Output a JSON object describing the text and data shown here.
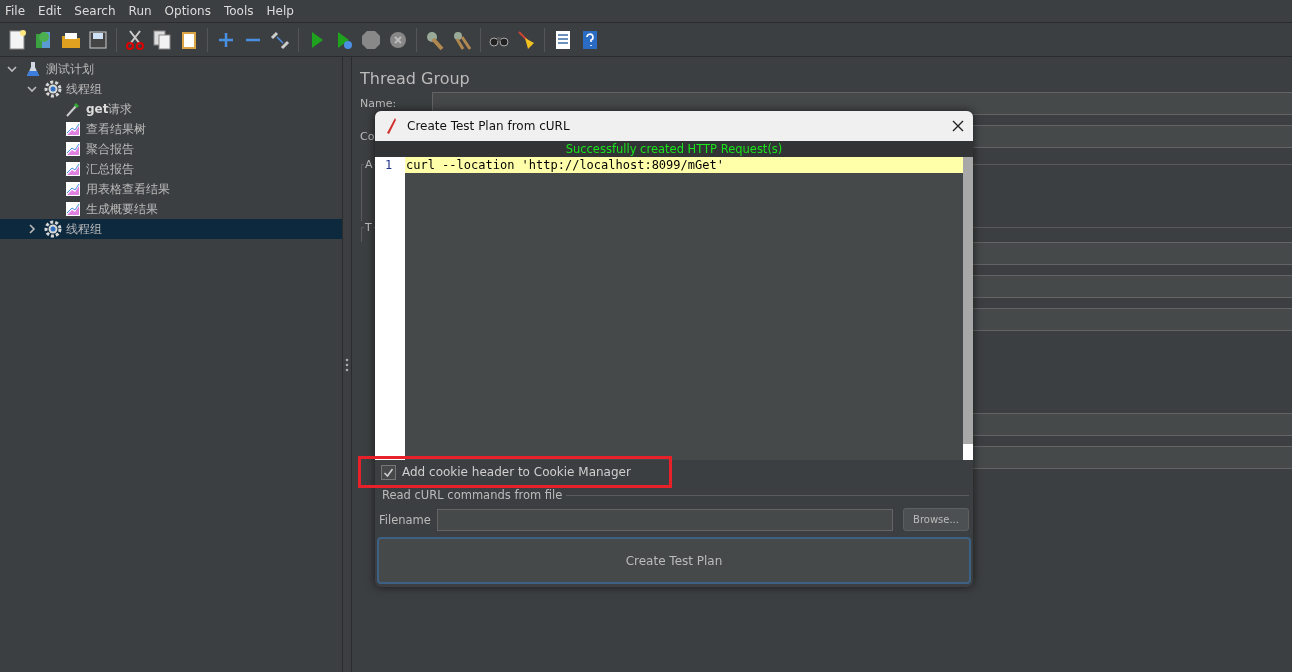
{
  "menu": [
    "File",
    "Edit",
    "Search",
    "Run",
    "Options",
    "Tools",
    "Help"
  ],
  "tree": [
    {
      "label": "测试计划",
      "kind": "plan",
      "expanded": true,
      "selected": false,
      "children": [
        {
          "label": "线程组",
          "kind": "thread-group",
          "expanded": true,
          "selected": false,
          "children": [
            {
              "label": "**get**请求",
              "kind": "sampler",
              "selected": false
            },
            {
              "label": "查看结果树",
              "kind": "listener",
              "selected": false
            },
            {
              "label": "聚合报告",
              "kind": "listener",
              "selected": false
            },
            {
              "label": "汇总报告",
              "kind": "listener",
              "selected": false
            },
            {
              "label": "用表格查看结果",
              "kind": "listener",
              "selected": false
            },
            {
              "label": "生成概要结果",
              "kind": "listener",
              "selected": false
            }
          ]
        },
        {
          "label": "线程组",
          "kind": "thread-group",
          "expanded": false,
          "selected": true
        }
      ]
    }
  ],
  "panel": {
    "title": "Thread Group",
    "name_label": "Name:",
    "comment_label": "Co",
    "section_1": "A",
    "section_2": "T"
  },
  "dialog": {
    "title": "Create Test Plan from cURL",
    "status": "Successfully created HTTP Request(s)",
    "line_numbers": [
      "1"
    ],
    "lines": [
      "curl --location 'http://localhost:8099/mGet'"
    ],
    "cookie_checkbox": {
      "label": "Add cookie header to Cookie Manager",
      "checked": true
    },
    "file_group": "Read cURL commands from file",
    "filename_label": "Filename",
    "browse": "Browse...",
    "create": "Create Test Plan"
  }
}
